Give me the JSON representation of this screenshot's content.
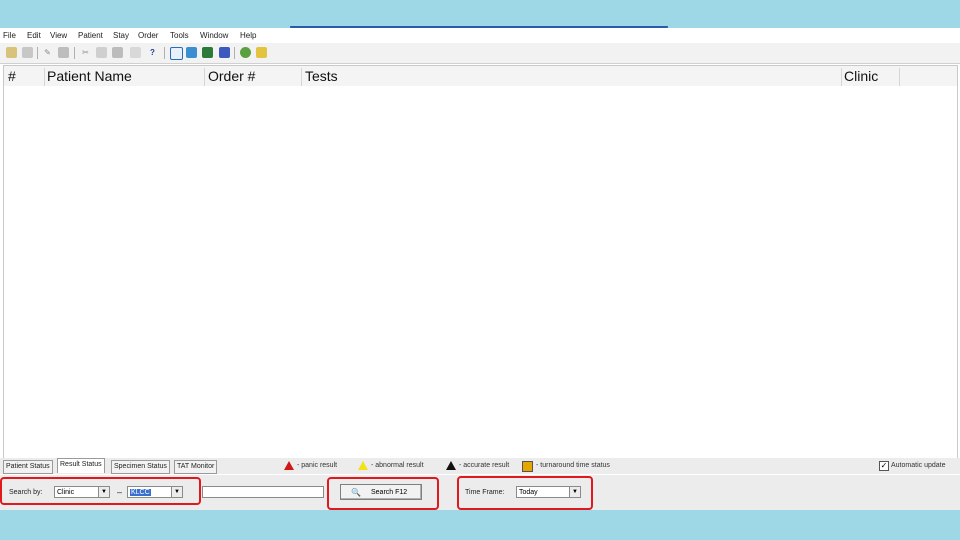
{
  "menu": [
    "File",
    "Edit",
    "View",
    "Patient",
    "Stay",
    "Order",
    "Tools",
    "Window",
    "Help"
  ],
  "toolbar_icons": [
    "open-icon",
    "disk-icon",
    "pencil-icon",
    "print-icon",
    "cut-icon",
    "copy-icon",
    "paste-icon",
    "help-pointer-icon",
    "window-icon",
    "tile-icon",
    "grid-icon",
    "arrow-icon",
    "refresh-icon",
    "wizard-icon"
  ],
  "list": {
    "columns": [
      "#",
      "Patient Name",
      "Order #",
      "Tests",
      "Clinic"
    ],
    "rows": []
  },
  "tabs": [
    {
      "label": "Patient Status",
      "active": false
    },
    {
      "label": "Result Status",
      "active": true
    },
    {
      "label": "Specimen Status",
      "active": false
    },
    {
      "label": "TAT Monitor",
      "active": false
    }
  ],
  "legend": {
    "panic": "- panic result",
    "abnormal": "- abnormal result",
    "accurate": "- accurate result",
    "turnaround": "- turnaround time status"
  },
  "legend_colors": {
    "panic": "#d01818",
    "abnormal": "#f2e21a",
    "accurate": "#111111",
    "turnaround": "#e6a600"
  },
  "automatic_update": {
    "label": "Automatic update",
    "checked": true
  },
  "search": {
    "search_by_label": "Search by:",
    "search_by_value": "Clinic",
    "dash": "–",
    "clinic_value": "KLCC",
    "text_value": "",
    "search_button": "Search  F12",
    "time_frame_label": "Time Frame:",
    "time_frame_value": "Today"
  },
  "highlight_color": "#e0191f"
}
